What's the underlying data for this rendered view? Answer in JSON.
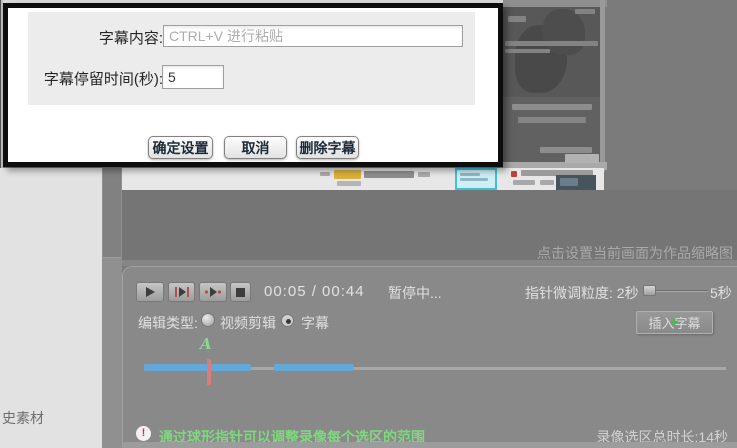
{
  "dialog": {
    "content_label": "字幕内容:",
    "content_placeholder": "CTRL+V 进行粘贴",
    "duration_label": "字幕停留时间(秒):",
    "duration_value": "5",
    "buttons": {
      "confirm": "确定设置",
      "cancel": "取消",
      "delete": "删除字幕"
    }
  },
  "sidebar": {
    "history_label": "史素材"
  },
  "preview": {
    "thumbnail_hint": "点击设置当前画面为作品缩略图"
  },
  "player": {
    "time": "00:05 / 00:44",
    "status": "暂停中...",
    "granularity_label": "指针微调粒度: 2秒",
    "granularity_max_label": "5秒"
  },
  "editor": {
    "type_label": "编辑类型:",
    "video_option": "视频剪辑",
    "subtitle_option": "字幕",
    "insert_plus": "+",
    "insert_button": "插入字幕",
    "marker_letter": "A"
  },
  "footer": {
    "warning_mark": "!",
    "hint": "通过球形指针可以调整录像每个选区的范围",
    "total_label": "录像选区总时长:14秒"
  },
  "colors": {
    "timeline_blue": "#63a8d8",
    "marker_red": "#d87c7c",
    "marker_green": "#8cd88c",
    "hint_green": "#7fd87f"
  }
}
